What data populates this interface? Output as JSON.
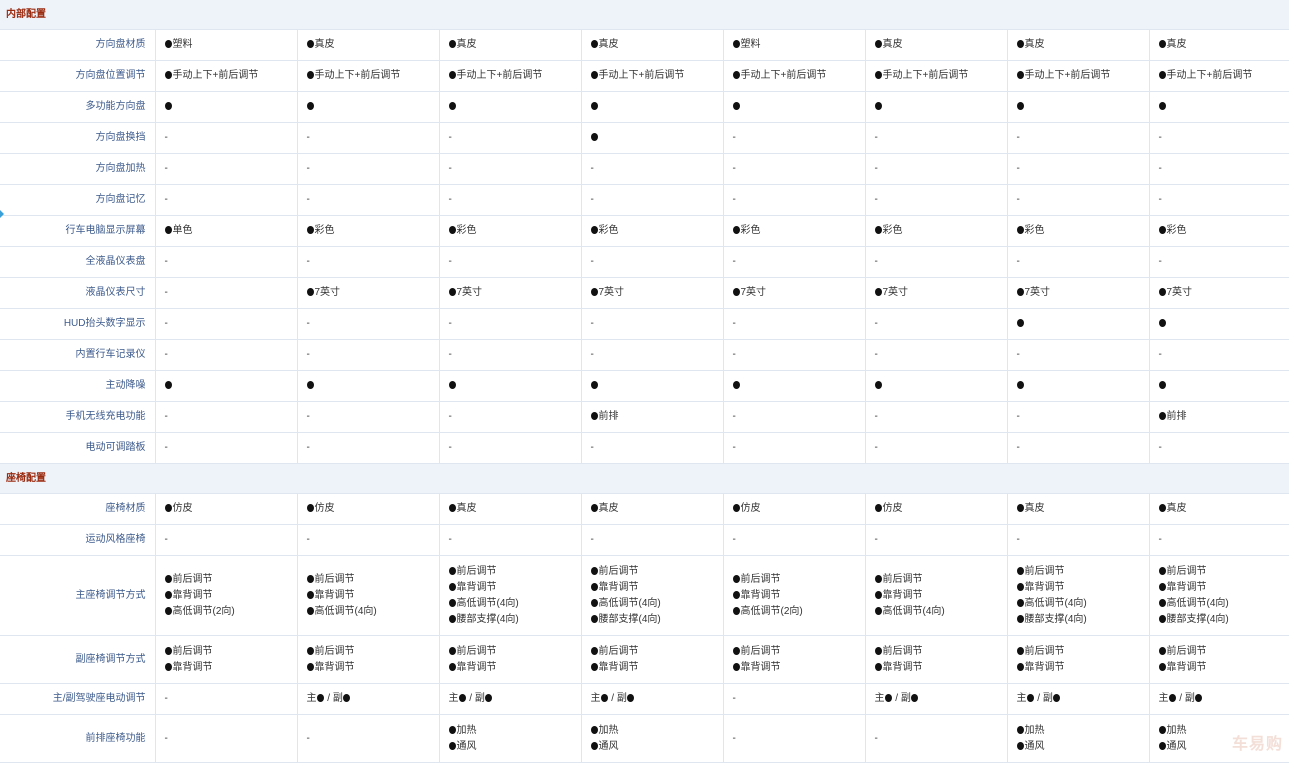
{
  "sections": [
    {
      "title": "内部配置",
      "rows": [
        {
          "label": "方向盘材质",
          "cells": [
            [
              "●塑料"
            ],
            [
              "●真皮"
            ],
            [
              "●真皮"
            ],
            [
              "●真皮"
            ],
            [
              "●塑料"
            ],
            [
              "●真皮"
            ],
            [
              "●真皮"
            ],
            [
              "●真皮"
            ]
          ]
        },
        {
          "label": "方向盘位置调节",
          "cells": [
            [
              "●手动上下+前后调节"
            ],
            [
              "●手动上下+前后调节"
            ],
            [
              "●手动上下+前后调节"
            ],
            [
              "●手动上下+前后调节"
            ],
            [
              "●手动上下+前后调节"
            ],
            [
              "●手动上下+前后调节"
            ],
            [
              "●手动上下+前后调节"
            ],
            [
              "●手动上下+前后调节"
            ]
          ]
        },
        {
          "label": "多功能方向盘",
          "cells": [
            [
              "●"
            ],
            [
              "●"
            ],
            [
              "●"
            ],
            [
              "●"
            ],
            [
              "●"
            ],
            [
              "●"
            ],
            [
              "●"
            ],
            [
              "●"
            ]
          ]
        },
        {
          "label": "方向盘换挡",
          "cells": [
            [
              "-"
            ],
            [
              "-"
            ],
            [
              "-"
            ],
            [
              "●"
            ],
            [
              "-"
            ],
            [
              "-"
            ],
            [
              "-"
            ],
            [
              "-"
            ]
          ]
        },
        {
          "label": "方向盘加热",
          "cells": [
            [
              "-"
            ],
            [
              "-"
            ],
            [
              "-"
            ],
            [
              "-"
            ],
            [
              "-"
            ],
            [
              "-"
            ],
            [
              "-"
            ],
            [
              "-"
            ]
          ]
        },
        {
          "label": "方向盘记忆",
          "cells": [
            [
              "-"
            ],
            [
              "-"
            ],
            [
              "-"
            ],
            [
              "-"
            ],
            [
              "-"
            ],
            [
              "-"
            ],
            [
              "-"
            ],
            [
              "-"
            ]
          ]
        },
        {
          "label": "行车电脑显示屏幕",
          "cells": [
            [
              "●单色"
            ],
            [
              "●彩色"
            ],
            [
              "●彩色"
            ],
            [
              "●彩色"
            ],
            [
              "●彩色"
            ],
            [
              "●彩色"
            ],
            [
              "●彩色"
            ],
            [
              "●彩色"
            ]
          ]
        },
        {
          "label": "全液晶仪表盘",
          "cells": [
            [
              "-"
            ],
            [
              "-"
            ],
            [
              "-"
            ],
            [
              "-"
            ],
            [
              "-"
            ],
            [
              "-"
            ],
            [
              "-"
            ],
            [
              "-"
            ]
          ]
        },
        {
          "label": "液晶仪表尺寸",
          "cells": [
            [
              "-"
            ],
            [
              "●7英寸"
            ],
            [
              "●7英寸"
            ],
            [
              "●7英寸"
            ],
            [
              "●7英寸"
            ],
            [
              "●7英寸"
            ],
            [
              "●7英寸"
            ],
            [
              "●7英寸"
            ]
          ]
        },
        {
          "label": "HUD抬头数字显示",
          "cells": [
            [
              "-"
            ],
            [
              "-"
            ],
            [
              "-"
            ],
            [
              "-"
            ],
            [
              "-"
            ],
            [
              "-"
            ],
            [
              "●"
            ],
            [
              "●"
            ]
          ]
        },
        {
          "label": "内置行车记录仪",
          "cells": [
            [
              "-"
            ],
            [
              "-"
            ],
            [
              "-"
            ],
            [
              "-"
            ],
            [
              "-"
            ],
            [
              "-"
            ],
            [
              "-"
            ],
            [
              "-"
            ]
          ]
        },
        {
          "label": "主动降噪",
          "cells": [
            [
              "●"
            ],
            [
              "●"
            ],
            [
              "●"
            ],
            [
              "●"
            ],
            [
              "●"
            ],
            [
              "●"
            ],
            [
              "●"
            ],
            [
              "●"
            ]
          ]
        },
        {
          "label": "手机无线充电功能",
          "cells": [
            [
              "-"
            ],
            [
              "-"
            ],
            [
              "-"
            ],
            [
              "●前排"
            ],
            [
              "-"
            ],
            [
              "-"
            ],
            [
              "-"
            ],
            [
              "●前排"
            ]
          ]
        },
        {
          "label": "电动可调踏板",
          "cells": [
            [
              "-"
            ],
            [
              "-"
            ],
            [
              "-"
            ],
            [
              "-"
            ],
            [
              "-"
            ],
            [
              "-"
            ],
            [
              "-"
            ],
            [
              "-"
            ]
          ]
        }
      ]
    },
    {
      "title": "座椅配置",
      "rows": [
        {
          "label": "座椅材质",
          "cells": [
            [
              "●仿皮"
            ],
            [
              "●仿皮"
            ],
            [
              "●真皮"
            ],
            [
              "●真皮"
            ],
            [
              "●仿皮"
            ],
            [
              "●仿皮"
            ],
            [
              "●真皮"
            ],
            [
              "●真皮"
            ]
          ]
        },
        {
          "label": "运动风格座椅",
          "cells": [
            [
              "-"
            ],
            [
              "-"
            ],
            [
              "-"
            ],
            [
              "-"
            ],
            [
              "-"
            ],
            [
              "-"
            ],
            [
              "-"
            ],
            [
              "-"
            ]
          ]
        },
        {
          "label": "主座椅调节方式",
          "height": 79,
          "cells": [
            [
              "●前后调节",
              "●靠背调节",
              "●高低调节(2向)"
            ],
            [
              "●前后调节",
              "●靠背调节",
              "●高低调节(4向)"
            ],
            [
              "●前后调节",
              "●靠背调节",
              "●高低调节(4向)",
              "●腰部支撑(4向)"
            ],
            [
              "●前后调节",
              "●靠背调节",
              "●高低调节(4向)",
              "●腰部支撑(4向)"
            ],
            [
              "●前后调节",
              "●靠背调节",
              "●高低调节(2向)"
            ],
            [
              "●前后调节",
              "●靠背调节",
              "●高低调节(4向)"
            ],
            [
              "●前后调节",
              "●靠背调节",
              "●高低调节(4向)",
              "●腰部支撑(4向)"
            ],
            [
              "●前后调节",
              "●靠背调节",
              "●高低调节(4向)",
              "●腰部支撑(4向)"
            ]
          ]
        },
        {
          "label": "副座椅调节方式",
          "height": 47,
          "cells": [
            [
              "●前后调节",
              "●靠背调节"
            ],
            [
              "●前后调节",
              "●靠背调节"
            ],
            [
              "●前后调节",
              "●靠背调节"
            ],
            [
              "●前后调节",
              "●靠背调节"
            ],
            [
              "●前后调节",
              "●靠背调节"
            ],
            [
              "●前后调节",
              "●靠背调节"
            ],
            [
              "●前后调节",
              "●靠背调节"
            ],
            [
              "●前后调节",
              "●靠背调节"
            ]
          ]
        },
        {
          "label": "主/副驾驶座电动调节",
          "cells": [
            [
              "-"
            ],
            [
              "主● / 副●"
            ],
            [
              "主● / 副●"
            ],
            [
              "主● / 副●"
            ],
            [
              "-"
            ],
            [
              "主● / 副●"
            ],
            [
              "主● / 副●"
            ],
            [
              "主● / 副●"
            ]
          ]
        },
        {
          "label": "前排座椅功能",
          "height": 47,
          "cells": [
            [
              "-"
            ],
            [
              "-"
            ],
            [
              "●加热",
              "●通风"
            ],
            [
              "●加热",
              "●通风"
            ],
            [
              "-"
            ],
            [
              "-"
            ],
            [
              "●加热",
              "●通风"
            ],
            [
              "●加热",
              "●通风"
            ]
          ]
        }
      ]
    }
  ],
  "watermark": "车易购"
}
